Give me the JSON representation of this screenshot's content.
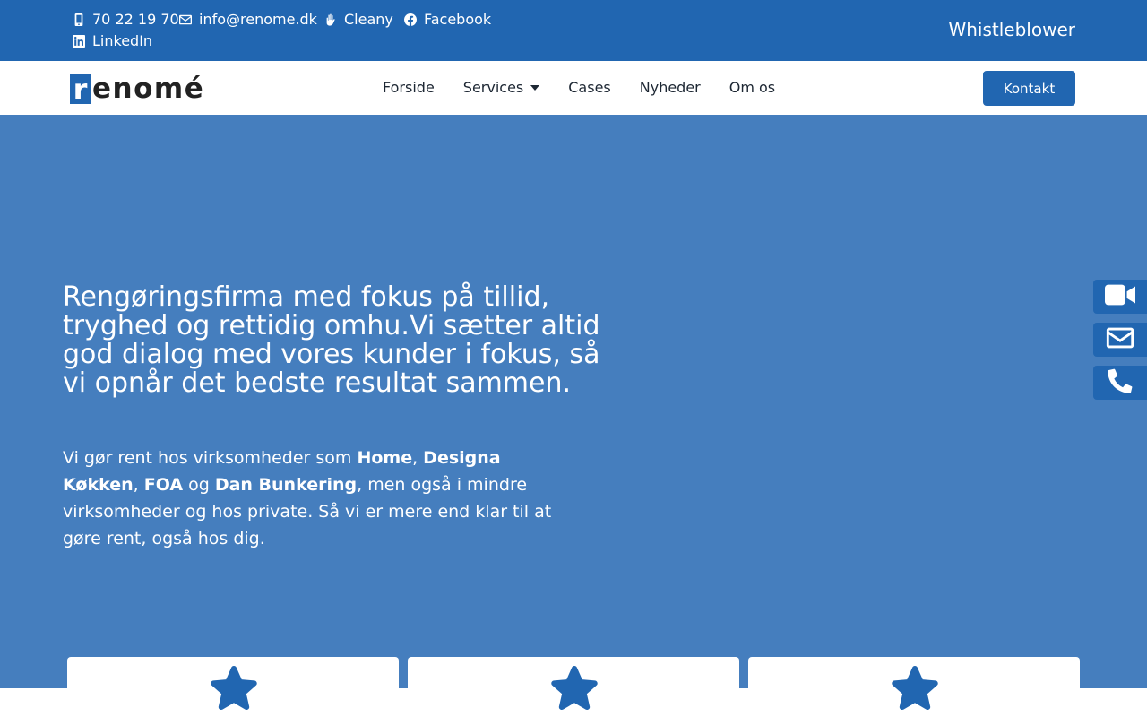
{
  "topbar": {
    "contacts": [
      {
        "icon": "mobile-phone-icon",
        "label": "70 22 19 70"
      },
      {
        "icon": "envelope-icon",
        "label": "info@renome.dk"
      },
      {
        "icon": "hands-icon",
        "label": "Cleany"
      },
      {
        "icon": "facebook-icon",
        "label": "Facebook"
      },
      {
        "icon": "linkedin-icon",
        "label": "LinkedIn"
      }
    ],
    "whistleblower": "Whistleblower"
  },
  "logo": {
    "first_letter": "r",
    "rest": "enomé"
  },
  "nav": {
    "items": [
      "Forside",
      "Services",
      "Cases",
      "Nyheder",
      "Om os"
    ],
    "kontakt": "Kontakt"
  },
  "hero": {
    "headline": "Rengøringsfirma med fokus på tillid, tryghed og rettidig omhu.Vi sætter altid god dialog med vores kunder i fokus, så vi opnår det bedste resultat sammen.",
    "desc": {
      "p1": "Vi gør rent hos virksomheder som ",
      "b1": "Home",
      "p2": ", ",
      "b2": "Designa Køkken",
      "p3": ", ",
      "b3": "FOA",
      "p4": " og ",
      "b4": "Dan Bunkering",
      "p5": ", men også i mindre virksomheder og hos private. Så vi er mere end klar til at gøre rent, også hos dig."
    }
  },
  "side_buttons": [
    "video-camera-icon",
    "envelope-icon",
    "phone-icon"
  ],
  "cards": [
    "star-icon",
    "star-icon",
    "star-icon"
  ],
  "colors": {
    "primary": "#2166b1",
    "hero_bg": "#457ebe",
    "text_dark": "#1d2733"
  }
}
